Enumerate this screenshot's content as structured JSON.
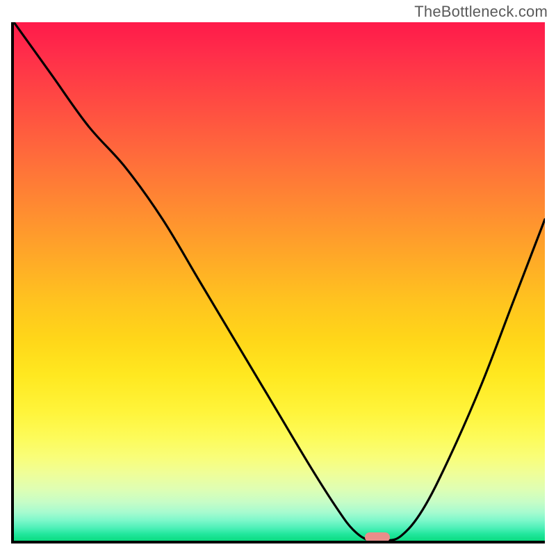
{
  "watermark": "TheBottleneck.com",
  "chart_data": {
    "type": "line",
    "title": "",
    "xlabel": "",
    "ylabel": "",
    "xlim": [
      0,
      100
    ],
    "ylim": [
      0,
      100
    ],
    "grid": false,
    "legend": false,
    "background": {
      "type": "vertical-gradient",
      "stops": [
        {
          "pos": 0,
          "color": "#ff1a4a"
        },
        {
          "pos": 50,
          "color": "#ffc41f"
        },
        {
          "pos": 80,
          "color": "#fdfb59"
        },
        {
          "pos": 100,
          "color": "#0bdb81"
        }
      ]
    },
    "series": [
      {
        "name": "bottleneck-curve",
        "color": "#000000",
        "x": [
          0,
          7,
          14,
          21,
          28,
          35,
          42,
          49,
          56,
          61,
          64,
          67,
          70,
          73,
          77,
          82,
          88,
          94,
          100
        ],
        "y": [
          100,
          90,
          80,
          72,
          62,
          50,
          38,
          26,
          14,
          6,
          2,
          0,
          0,
          1,
          6,
          16,
          30,
          46,
          62
        ]
      }
    ],
    "marker": {
      "name": "optimal-point",
      "x": 68.5,
      "y": 0.7,
      "color": "#e98d8a",
      "shape": "pill"
    }
  }
}
